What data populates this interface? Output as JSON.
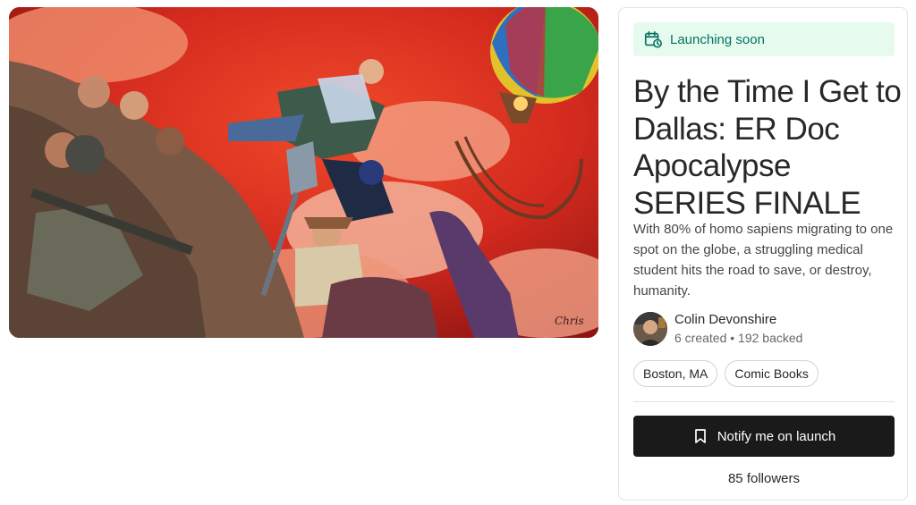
{
  "hero": {
    "image_icon": "comic-cover-illustration"
  },
  "project": {
    "status_badge": "Launching soon",
    "status_icon": "calendar-clock-icon",
    "title": "By the Time I Get to Dallas: ER Doc Apocalypse SERIES FINALE",
    "description": "With 80% of homo sapiens migrating to one spot on the globe, a struggling medical student hits the road to save, or destroy, humanity."
  },
  "creator": {
    "name": "Colin Devonshire",
    "stats": "6 created • 192 backed"
  },
  "tags": [
    "Boston, MA",
    "Comic Books"
  ],
  "actions": {
    "notify_label": "Notify me on launch",
    "notify_icon": "bookmark-icon",
    "followers": "85 followers"
  },
  "colors": {
    "badge_bg": "#e6fbee",
    "badge_text": "#037362",
    "button_bg": "#1a1a1a"
  }
}
